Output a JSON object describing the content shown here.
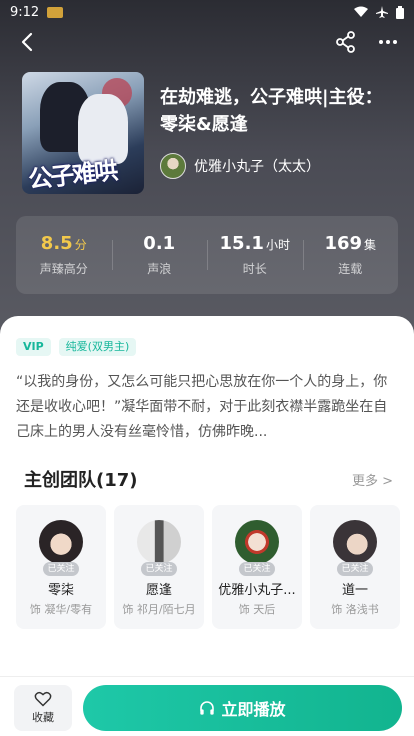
{
  "status": {
    "time": "9:12"
  },
  "book": {
    "title": "在劫难逃，公子难哄|主役：零柒&愿逢",
    "author": "优雅小丸子（太太）",
    "cover_text": "公子难哄"
  },
  "stats": [
    {
      "value": "8.5",
      "unit": "分",
      "label": "声臻高分"
    },
    {
      "value": "0.1",
      "unit": "",
      "label": "声浪"
    },
    {
      "value": "15.1",
      "unit": "小时",
      "label": "时长"
    },
    {
      "value": "169",
      "unit": "集",
      "label": "连载"
    }
  ],
  "tags": [
    "VIP",
    "纯爱(双男主)"
  ],
  "description": "“以我的身份，又怎么可能只把心思放在你一个人的身上，你还是收收心吧！”凝华面带不耐，对于此刻衣襟半露跪坐在自己床上的男人没有丝毫怜惜，仿佛昨晚...",
  "team": {
    "title": "主创团队(17)",
    "more": "更多 >",
    "members": [
      {
        "name": "零柒",
        "badge": "已关注",
        "role": "饰 凝华/零有"
      },
      {
        "name": "愿逢",
        "badge": "已关注",
        "role": "饰 祁月/陌七月"
      },
      {
        "name": "优雅小丸子...",
        "badge": "已关注",
        "role": "饰 天后"
      },
      {
        "name": "道一",
        "badge": "已关注",
        "role": "饰 洛浅书"
      }
    ]
  },
  "bottom": {
    "fav_label": "收藏",
    "play_label": "立即播放"
  },
  "colors": {
    "accent": "#17b79b",
    "gold": "#f2c94c"
  }
}
